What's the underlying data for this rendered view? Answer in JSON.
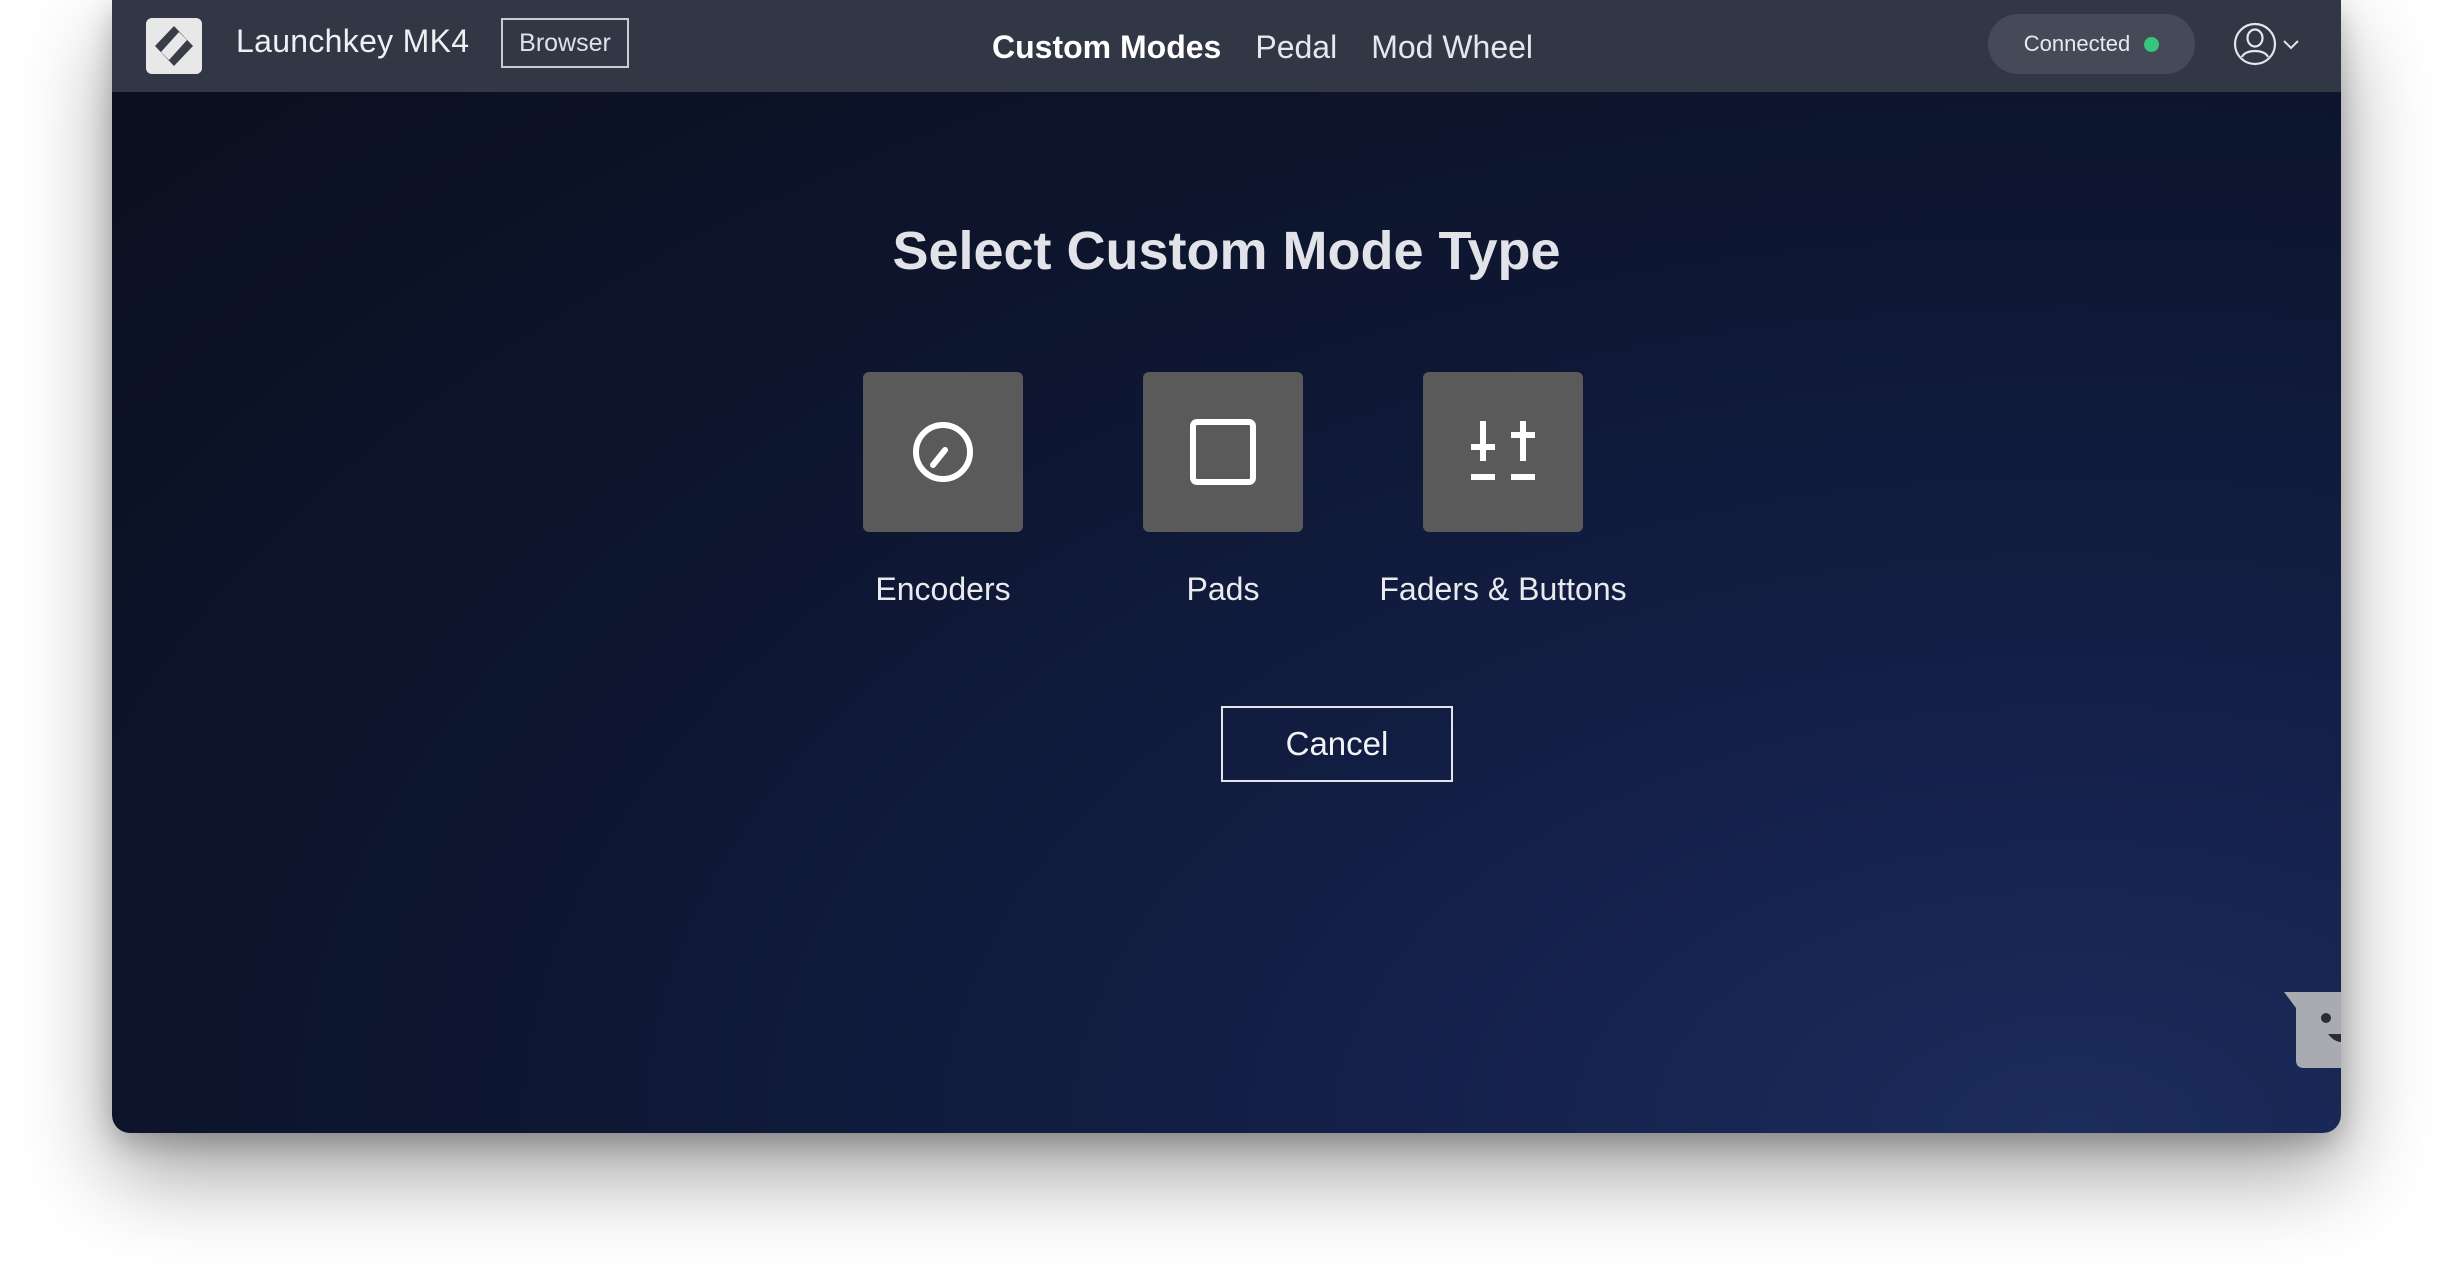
{
  "app": {
    "title": "Launchkey MK4",
    "browser_button": "Browser",
    "logo_icon": "launchkey-logo-icon"
  },
  "nav": {
    "items": [
      {
        "label": "Custom Modes",
        "active": true
      },
      {
        "label": "Pedal",
        "active": false
      },
      {
        "label": "Mod Wheel",
        "active": false
      }
    ]
  },
  "status": {
    "label": "Connected",
    "color": "#35c57d"
  },
  "account": {
    "icon": "user-account-icon",
    "dropdown_icon": "chevron-down-icon"
  },
  "dialog": {
    "heading": "Select Custom Mode Type",
    "options": [
      {
        "label": "Encoders",
        "icon": "knob-icon"
      },
      {
        "label": "Pads",
        "icon": "square-pad-icon"
      },
      {
        "label": "Faders & Buttons",
        "icon": "faders-icon"
      }
    ],
    "cancel": "Cancel"
  },
  "help": {
    "icon": "chat-bot-icon"
  },
  "colors": {
    "topbar": "#323746",
    "tile": "#5a5a5a",
    "background_dark": "#0a0f1c",
    "background_accent": "#1c2c5c"
  }
}
